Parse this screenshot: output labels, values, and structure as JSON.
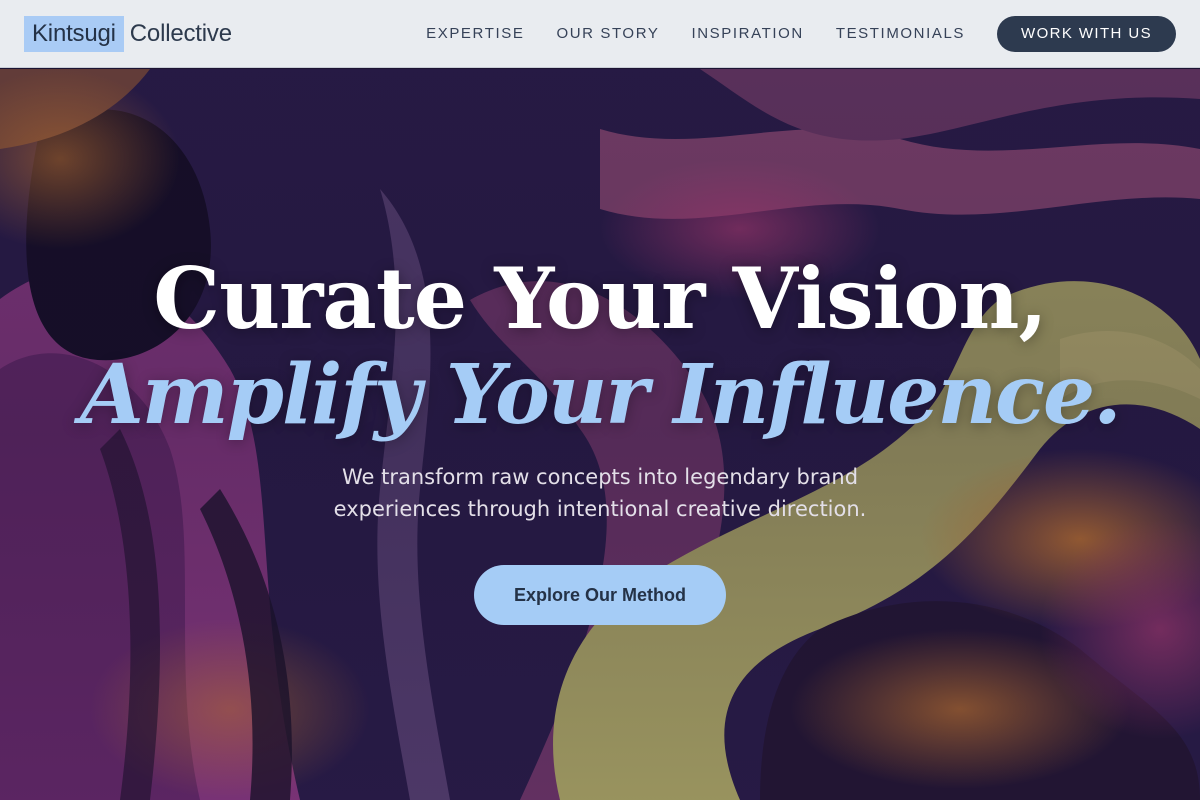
{
  "brand": {
    "mark": "Kintsugi",
    "name": "Collective"
  },
  "nav": {
    "items": [
      {
        "label": "EXPERTISE"
      },
      {
        "label": "OUR STORY"
      },
      {
        "label": "INSPIRATION"
      },
      {
        "label": "TESTIMONIALS"
      }
    ],
    "cta_label": "WORK WITH US"
  },
  "hero": {
    "headline_line1": "Curate Your Vision,",
    "headline_line2": "Amplify Your Influence.",
    "subheadline": "We transform raw concepts into legendary brand experiences through intentional creative direction.",
    "cta_label": "Explore Our Method"
  },
  "colors": {
    "header_bg": "#e9ecf0",
    "accent": "#a5ccf6",
    "dark_button": "#2d3a4f",
    "hero_dark": "#1c1433"
  },
  "icons": [
    "abstract-brushstroke-background"
  ]
}
